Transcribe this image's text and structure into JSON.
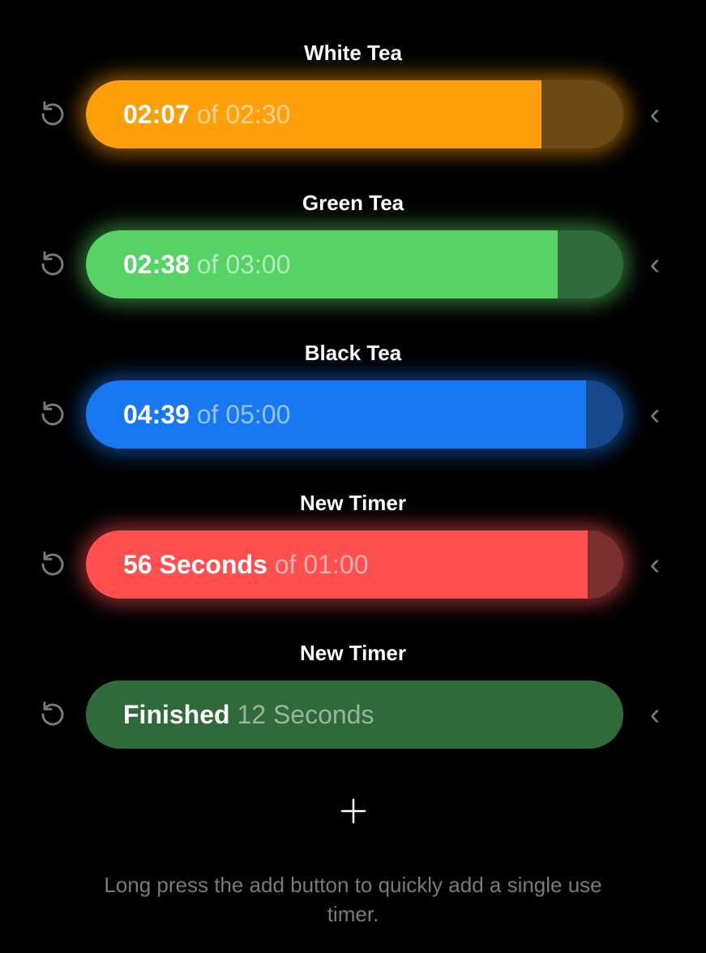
{
  "timers": [
    {
      "title": "White Tea",
      "primary": "02:07",
      "secondary": "of 02:30",
      "fillColor": "#ff9f0a",
      "bgColor": "#6b4a17",
      "secondaryColor": "rgba(255,255,255,0.55)",
      "glowColor": "#ff9f0a",
      "fillPercent": 84.7,
      "showGlow": true
    },
    {
      "title": "Green Tea",
      "primary": "02:38",
      "secondary": "of 03:00",
      "fillColor": "#56d364",
      "bgColor": "#2f6b3a",
      "secondaryColor": "rgba(255,255,255,0.55)",
      "glowColor": "#56d364",
      "fillPercent": 87.8,
      "showGlow": true
    },
    {
      "title": "Black Tea",
      "primary": "04:39",
      "secondary": "of 05:00",
      "fillColor": "#1878f2",
      "bgColor": "#16468c",
      "secondaryColor": "rgba(255,255,255,0.55)",
      "glowColor": "#1878f2",
      "fillPercent": 93.0,
      "showGlow": true
    },
    {
      "title": "New Timer",
      "primary": "56 Seconds",
      "secondary": "of 01:00",
      "fillColor": "#ff4f4f",
      "bgColor": "#7a2f2f",
      "secondaryColor": "rgba(255,255,255,0.55)",
      "glowColor": "#ff4f4f",
      "fillPercent": 93.3,
      "showGlow": true
    },
    {
      "title": "New Timer",
      "primary": "Finished",
      "secondary": "12 Seconds",
      "fillColor": "#2f6b3a",
      "bgColor": "#2f6b3a",
      "secondaryColor": "rgba(255,255,255,0.5)",
      "glowColor": "#2f6b3a",
      "fillPercent": 100,
      "showGlow": false
    }
  ],
  "hint": "Long press the add button to quickly add a single use timer."
}
